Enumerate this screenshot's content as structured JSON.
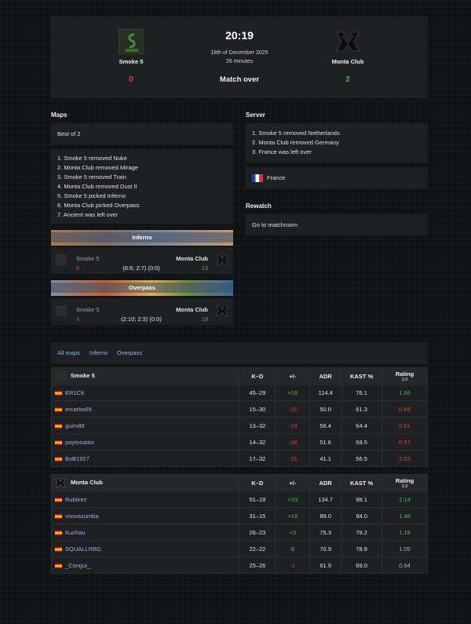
{
  "match": {
    "time": "20:19",
    "date": "18th of December 2025",
    "duration": "26 minutes",
    "status": "Match over",
    "team1": {
      "name": "Smoke 5",
      "score": "0"
    },
    "team2": {
      "name": "Monta Club",
      "score": "2"
    }
  },
  "maps": {
    "title": "Maps",
    "format": "Best of 2",
    "veto": [
      "1. Smoke 5 removed Nuke",
      "2. Monta Club removed Mirage",
      "3. Smoke 5 removed Train",
      "4. Monta Club removed Dust II",
      "5. Smoke 5 picked Inferno",
      "6. Monta Club picked Overpass",
      "7. Ancient was left over"
    ],
    "results": [
      {
        "map": "Inferno",
        "team1": "Smoke 5",
        "team2": "Monta Club",
        "score1": "6",
        "score2": "13",
        "halves": "(6:6; 2:7) (0:0)"
      },
      {
        "map": "Overpass",
        "team1": "Smoke 5",
        "team2": "Monta Club",
        "score1": "4",
        "score2": "13",
        "halves": "(2:10; 2:3) (0:0)"
      }
    ]
  },
  "server": {
    "title": "Server",
    "veto": [
      "1. Smoke 5 removed Netherlands",
      "2. Monta Club removed Germany",
      "3. France was left over"
    ],
    "location": "France"
  },
  "rewatch": {
    "title": "Rewatch",
    "link": "Go to matchroom"
  },
  "tabs": [
    "All maps",
    "Inferno",
    "Overpass"
  ],
  "stats_headers": {
    "kd": "K–D",
    "pm": "+/-",
    "adr": "ADR",
    "kast": "KAST %",
    "rating": "Rating",
    "rating_ver": "2.0"
  },
  "teams": [
    {
      "name": "Smoke 5",
      "players": [
        {
          "name": "ER1CK",
          "kd": "45–29",
          "pm": "+16",
          "adr": "114.4",
          "kast": "76.1",
          "rating": "1.66"
        },
        {
          "name": "ercarbo69",
          "kd": "15–30",
          "pm": "-15",
          "adr": "50.0",
          "kast": "61.3",
          "rating": "0.69"
        },
        {
          "name": "guim88",
          "kd": "13–32",
          "pm": "-19",
          "adr": "56.4",
          "kast": "64.4",
          "rating": "0.61"
        },
        {
          "name": "paytonaitor",
          "kd": "14–32",
          "pm": "-18",
          "adr": "51.6",
          "kast": "59.5",
          "rating": "0.57"
        },
        {
          "name": "BoB1927",
          "kd": "17–32",
          "pm": "-15",
          "adr": "41.1",
          "kast": "56.5",
          "rating": "0.53"
        }
      ]
    },
    {
      "name": "Monta Club",
      "players": [
        {
          "name": "Rubiirez",
          "kd": "51–18",
          "pm": "+33",
          "adr": "134.7",
          "kast": "98.1",
          "rating": "2.14"
        },
        {
          "name": "voovazumba",
          "kd": "31–15",
          "pm": "+16",
          "adr": "89.0",
          "kast": "94.0",
          "rating": "1.48"
        },
        {
          "name": "Kuchau",
          "kd": "26–23",
          "pm": "+3",
          "adr": "75.3",
          "kast": "79.2",
          "rating": "1.18"
        },
        {
          "name": "SQUALLRBG",
          "kd": "22–22",
          "pm": "0",
          "adr": "70.9",
          "kast": "78.9",
          "rating": "1.05"
        },
        {
          "name": "_Congui_",
          "kd": "25–26",
          "pm": "-1",
          "adr": "61.9",
          "kast": "69.0",
          "rating": "0.94"
        }
      ]
    }
  ],
  "colors": {
    "positive": "#3fbf3f",
    "negative": "#e0403c",
    "neutral": "#b0b0b0",
    "link": "#8fb4e8"
  }
}
